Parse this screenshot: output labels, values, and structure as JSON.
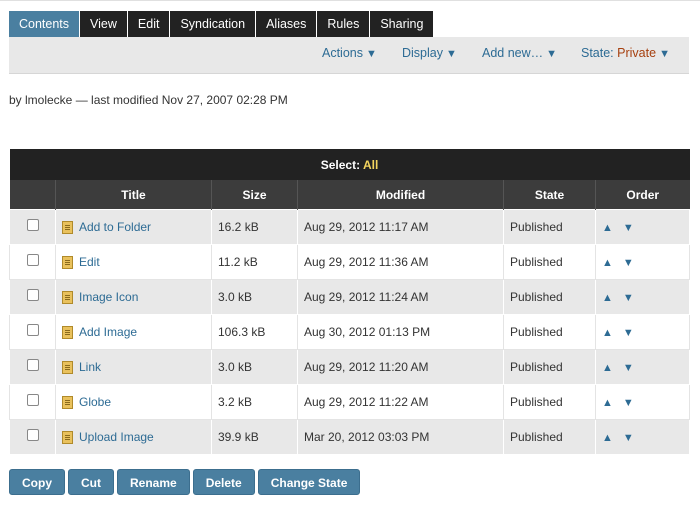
{
  "tabs": [
    {
      "label": "Contents",
      "active": true
    },
    {
      "label": "View",
      "active": false
    },
    {
      "label": "Edit",
      "active": false
    },
    {
      "label": "Syndication",
      "active": false
    },
    {
      "label": "Aliases",
      "active": false
    },
    {
      "label": "Rules",
      "active": false
    },
    {
      "label": "Sharing",
      "active": false
    }
  ],
  "toolbar": {
    "actions": "Actions",
    "display": "Display",
    "add_new": "Add new…",
    "state_label": "State:",
    "state_value": "Private",
    "arrow": "▼"
  },
  "byline": "by lmolecke — last modified Nov 27, 2007 02:28 PM",
  "table": {
    "select_label": "Select:",
    "select_all": "All",
    "headers": {
      "title": "Title",
      "size": "Size",
      "modified": "Modified",
      "state": "State",
      "order": "Order"
    },
    "rows": [
      {
        "title": "Add to Folder",
        "size": "16.2 kB",
        "modified": "Aug 29, 2012 11:17 AM",
        "state": "Published"
      },
      {
        "title": "Edit",
        "size": "11.2 kB",
        "modified": "Aug 29, 2012 11:36 AM",
        "state": "Published"
      },
      {
        "title": "Image Icon",
        "size": "3.0 kB",
        "modified": "Aug 29, 2012 11:24 AM",
        "state": "Published"
      },
      {
        "title": "Add Image",
        "size": "106.3 kB",
        "modified": "Aug 30, 2012 01:13 PM",
        "state": "Published"
      },
      {
        "title": "Link",
        "size": "3.0 kB",
        "modified": "Aug 29, 2012 11:20 AM",
        "state": "Published"
      },
      {
        "title": "Globe",
        "size": "3.2 kB",
        "modified": "Aug 29, 2012 11:22 AM",
        "state": "Published"
      },
      {
        "title": "Upload Image",
        "size": "39.9 kB",
        "modified": "Mar 20, 2012 03:03 PM",
        "state": "Published"
      }
    ],
    "order_up": "▲",
    "order_down": "▼"
  },
  "buttons": {
    "copy": "Copy",
    "cut": "Cut",
    "rename": "Rename",
    "delete": "Delete",
    "change_state": "Change State"
  },
  "colors": {
    "tab_active": "#4a7fa0",
    "tab": "#222222",
    "link": "#2d6b94",
    "state_private": "#a6400f",
    "select_all": "#f4d55e"
  }
}
